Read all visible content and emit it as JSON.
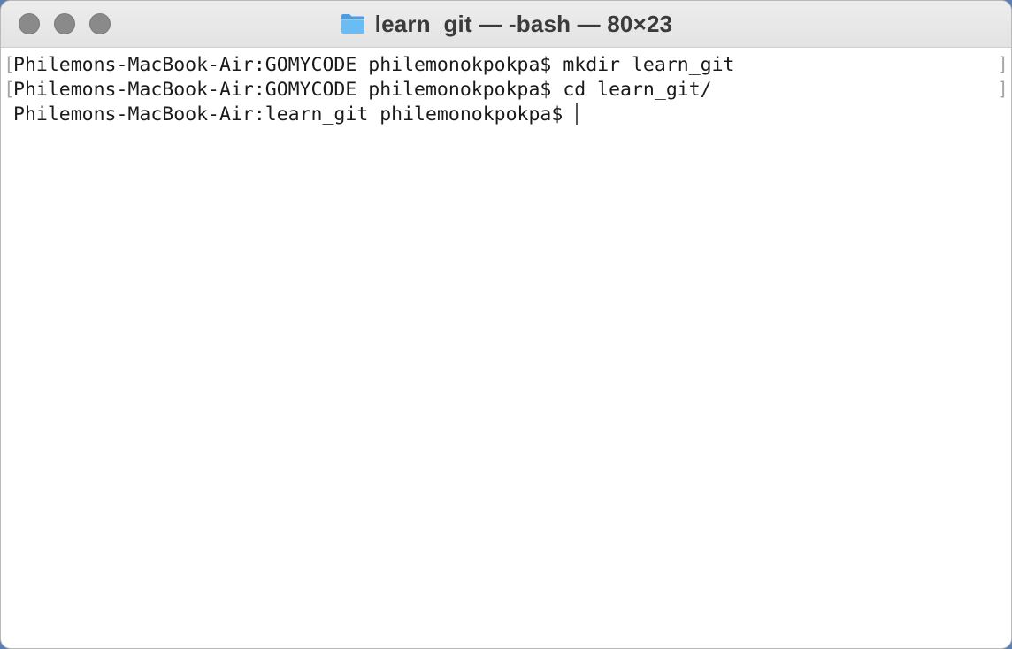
{
  "window": {
    "title": "learn_git — -bash — 80×23",
    "title_icon": "folder-icon"
  },
  "terminal": {
    "lines": [
      {
        "text": "Philemons-MacBook-Air:GOMYCODE philemonokpokpa$ mkdir learn_git",
        "marked": true
      },
      {
        "text": "Philemons-MacBook-Air:GOMYCODE philemonokpokpa$ cd learn_git/",
        "marked": true
      },
      {
        "text": "Philemons-MacBook-Air:learn_git philemonokpokpa$ ",
        "marked": false
      }
    ]
  },
  "colors": {
    "folder": "#5eb0ec",
    "traffic_light": "#8a8a8a",
    "marker": "#a6a6a6"
  }
}
